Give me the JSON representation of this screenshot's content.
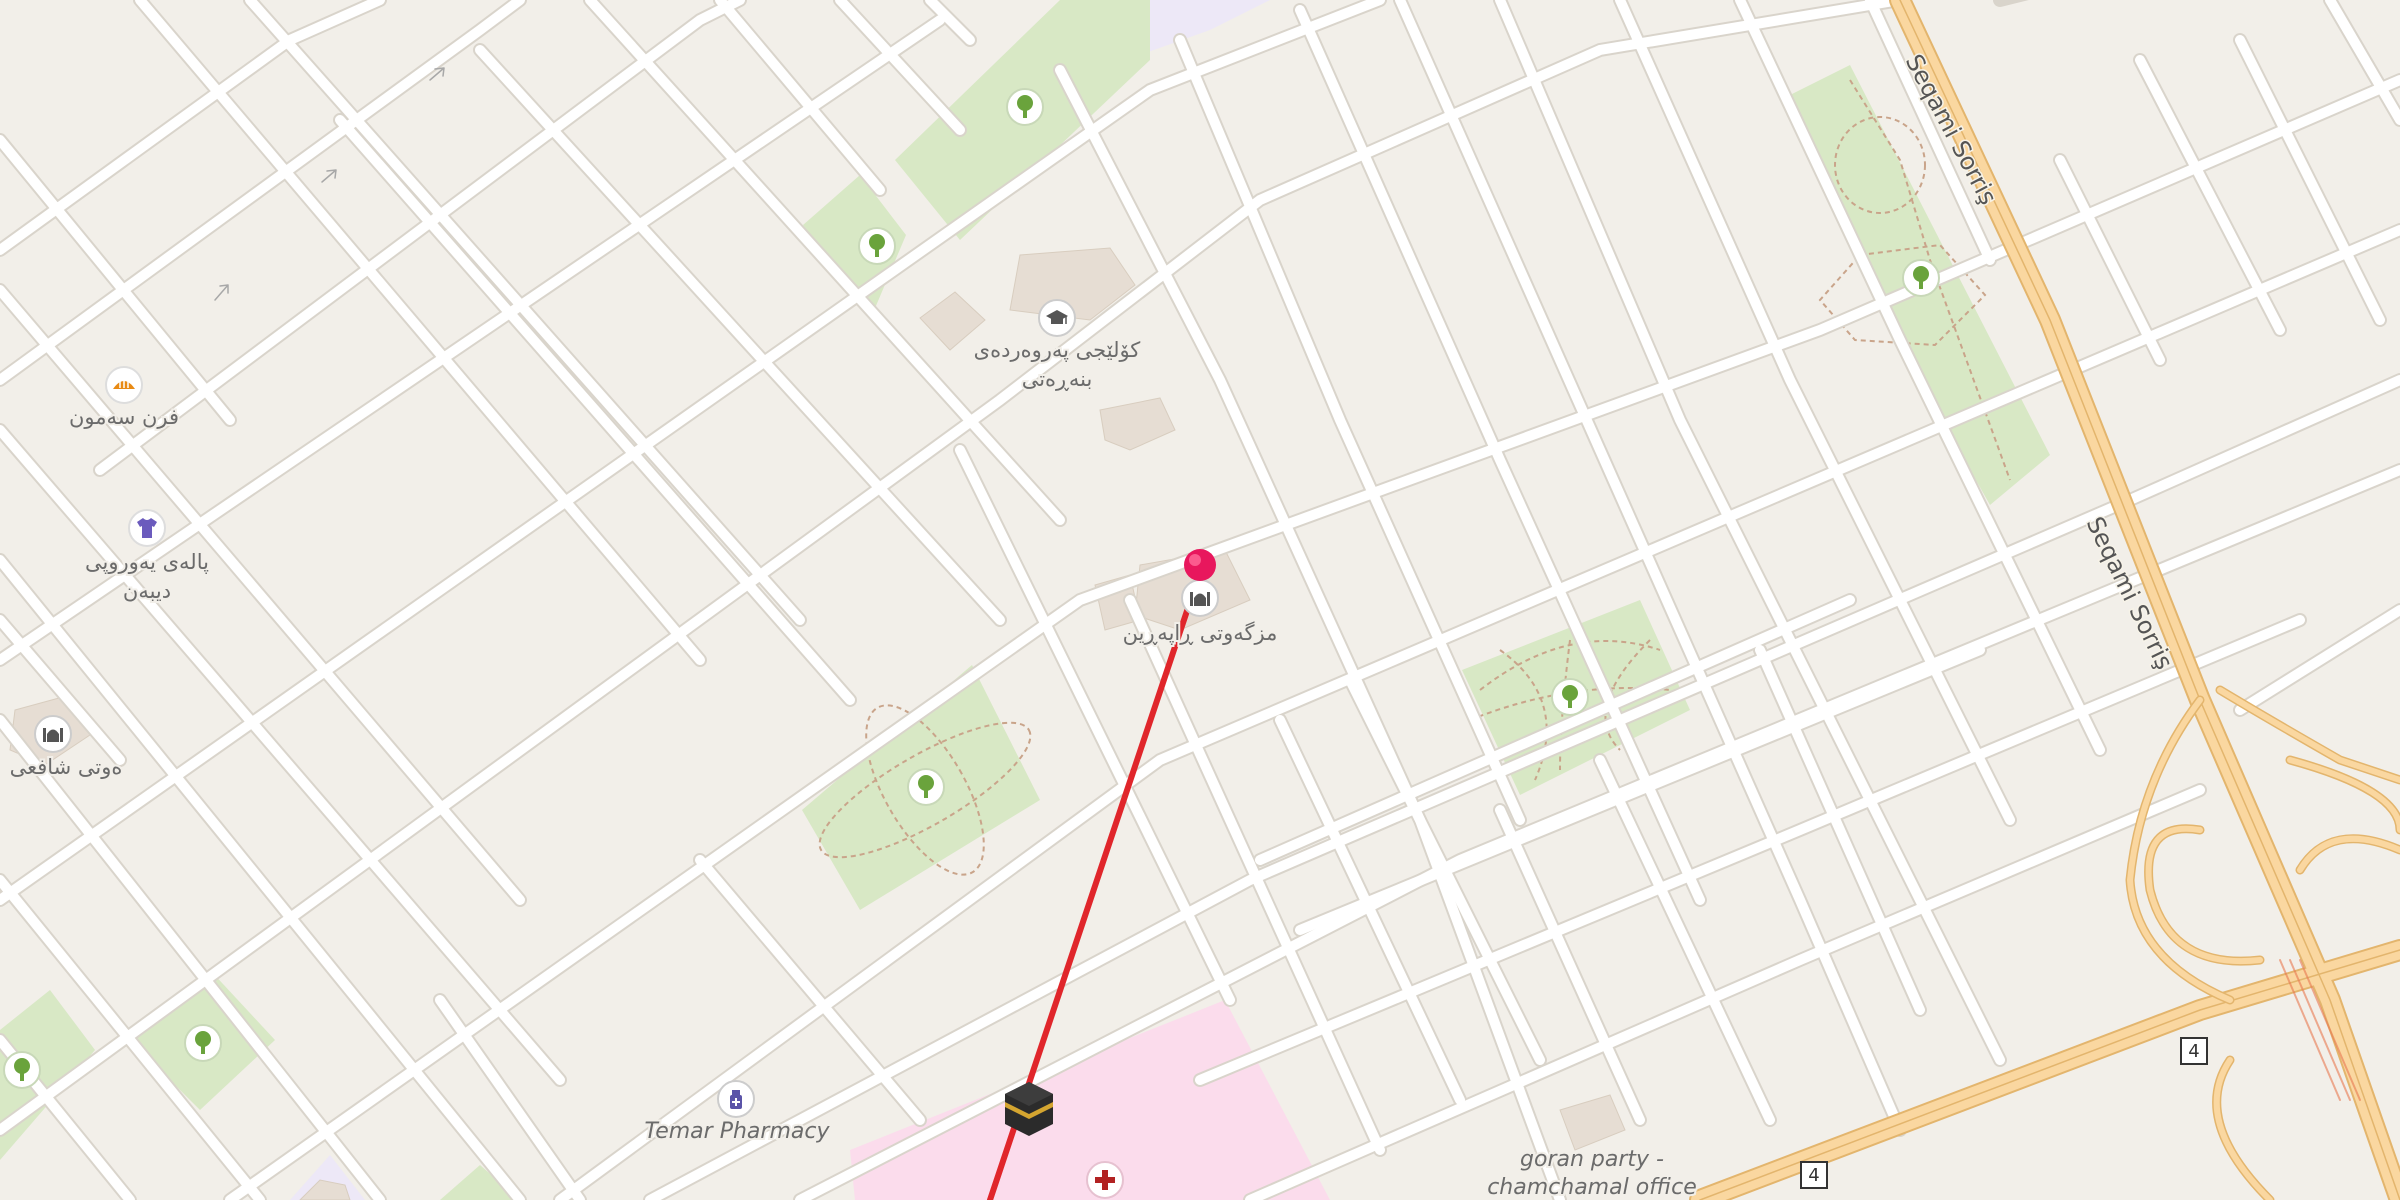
{
  "map": {
    "colors": {
      "background": "#f2efe9",
      "street": "#ffffff",
      "street_casing": "#d9d4cb",
      "motorway": "#fad7a0",
      "motorway_casing": "#e3b56d",
      "park": "#d8e8c5",
      "hospital": "#fbdcec",
      "school": "#ede8f7",
      "building": "#e6ddd3",
      "route": "#e0262b",
      "pin": "#e8175d"
    },
    "road_labels": [
      {
        "id": "seqami-sorris-1",
        "text": "Seqami Sorriş"
      },
      {
        "id": "seqami-sorris-2",
        "text": "Seqami Sorriş"
      }
    ],
    "route_shields": [
      {
        "id": "shield-1",
        "text": "4"
      },
      {
        "id": "shield-2",
        "text": "4"
      }
    ],
    "pois": [
      {
        "id": "college",
        "icon": "graduation-cap-icon",
        "lines": [
          "کۆلێجی پەروەردەی",
          "بنەڕەتی"
        ]
      },
      {
        "id": "bakery",
        "icon": "bakery-icon",
        "lines": [
          "فرن سەمون"
        ]
      },
      {
        "id": "clothes-shop",
        "icon": "clothes-shop-icon",
        "lines": [
          "پالەی یەوروپی",
          "دیبەن"
        ]
      },
      {
        "id": "mosque-shafii",
        "icon": "mosque-icon",
        "lines": [
          "ەوتی شافعی"
        ]
      },
      {
        "id": "mosque-main",
        "icon": "mosque-icon",
        "lines": [
          "مزگەوتی ڕاپەڕین"
        ]
      },
      {
        "id": "pharmacy",
        "icon": "pharmacy-icon",
        "lines": [
          "Temar Pharmacy"
        ]
      },
      {
        "id": "office",
        "icon": "none",
        "lines": [
          "goran party -",
          "chamchamal office"
        ]
      },
      {
        "id": "hospital",
        "icon": "hospital-cross-icon",
        "lines": []
      },
      {
        "id": "kaaba",
        "icon": "kaaba-icon",
        "lines": []
      }
    ],
    "park_icon": "tree-icon",
    "marker_icon": "map-pin-icon"
  }
}
